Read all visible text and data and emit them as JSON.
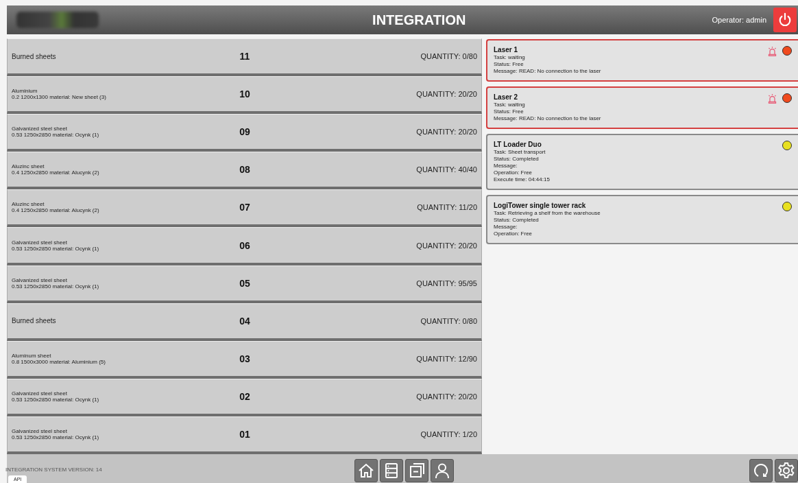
{
  "header": {
    "title": "INTEGRATION",
    "operator": "Operator: admin"
  },
  "slots": [
    {
      "name": "Burned sheets",
      "number": "11",
      "quantity": "QUANTITY: 0/80"
    },
    {
      "name": "Aluminium",
      "detail": "0.2 1200x1300 material:  New sheet  (3)",
      "number": "10",
      "quantity": "QUANTITY: 20/20"
    },
    {
      "name": "Galvanized steel sheet",
      "detail": "0.53 1250x2850 material: Ocynk (1)",
      "number": "09",
      "quantity": "QUANTITY: 20/20"
    },
    {
      "name": "Aluzinc sheet",
      "detail": "0.4 1250x2850 material: Alucynk (2)",
      "number": "08",
      "quantity": "QUANTITY: 40/40"
    },
    {
      "name": "Aluzinc sheet",
      "detail": "0.4 1250x2850 material: Alucynk (2)",
      "number": "07",
      "quantity": "QUANTITY: 11/20"
    },
    {
      "name": "Galvanized steel sheet",
      "detail": "0.53 1250x2850 material: Ocynk (1)",
      "number": "06",
      "quantity": "QUANTITY: 20/20"
    },
    {
      "name": "Galvanized steel sheet",
      "detail": "0.53 1250x2850 material: Ocynk (1)",
      "number": "05",
      "quantity": "QUANTITY: 95/95"
    },
    {
      "name": "Burned sheets",
      "number": "04",
      "quantity": "QUANTITY: 0/80"
    },
    {
      "name": "Aluminum sheet",
      "detail": "0.8 1500x3000 material: Aluminium (5)",
      "number": "03",
      "quantity": "QUANTITY: 12/90"
    },
    {
      "name": "Galvanized steel sheet",
      "detail": "0.53 1250x2850 material: Ocynk (1)",
      "number": "02",
      "quantity": "QUANTITY: 20/20"
    },
    {
      "name": "Galvanized steel sheet",
      "detail": "0.53 1250x2850 material: Ocynk (1)",
      "number": "01",
      "quantity": "QUANTITY: 1/20"
    }
  ],
  "devices": [
    {
      "name": "Laser 1",
      "alarm": true,
      "color": "#f04a1e",
      "lines": [
        "Task: waiting",
        "Status: Free",
        "Message: READ: No connection to the laser"
      ]
    },
    {
      "name": "Laser 2",
      "alarm": true,
      "color": "#f04a1e",
      "lines": [
        "Task: waiting",
        "Status: Free",
        "Message: READ: No connection to the laser"
      ]
    },
    {
      "name": "LT Loader Duo",
      "alarm": false,
      "color": "#e8e020",
      "lines": [
        "Task: Sheet transport",
        "Status: Completed",
        "Message:",
        "Operation: Free",
        "Execute time: 04:44:15"
      ]
    },
    {
      "name": "LogiTower single tower rack",
      "alarm": false,
      "color": "#e8e020",
      "lines": [
        "Task: Retrieving a shelf from the warehouse",
        "Status: Completed",
        "Message:",
        "Operation: Free"
      ]
    }
  ],
  "footer": {
    "version": "INTEGRATION SYSTEM VERSION: 14",
    "api_tab": "API"
  }
}
